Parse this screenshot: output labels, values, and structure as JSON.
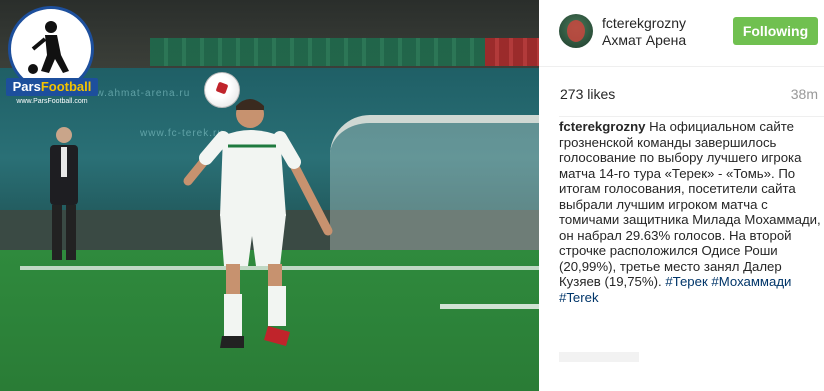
{
  "logo": {
    "brand_left": "Pars",
    "brand_right": "Football",
    "url": "www.ParsFootball.com"
  },
  "photo": {
    "board_text": "www.ahmat-arena.ru",
    "board_text2": "www.fc-terek.ru"
  },
  "post": {
    "username": "fcterekgrozny",
    "location": "Ахмат Арена",
    "follow_label": "Following",
    "likes": "273 likes",
    "time": "38m",
    "caption_text": "На официальном сайте грозненской команды завершилось голосование по выбору лучшего игрока матча 14-го тура «Терек» - «Томь». По итогам голосования, посетители сайта выбрали лучшим игроком матча с томичами защитника Милада Мохаммади, он набрал 29.63% голосов. На второй строчке расположился Одисе Роши (20,99%), третье место занял Далер Кузяев (19,75%).",
    "hashtags": [
      "#Терек",
      "#Мохаммади",
      "#Terek"
    ]
  },
  "colors": {
    "follow_bg": "#70c050",
    "hashtag": "#003569",
    "logo_blue": "#1d4f9c"
  }
}
